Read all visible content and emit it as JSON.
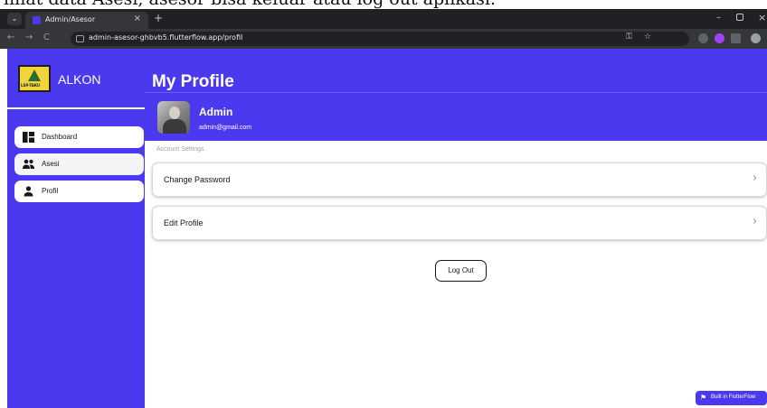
{
  "document_caption": "lihat data Asesi, asesor bisa keluar atau log out aplikasi.",
  "browser": {
    "tab_title": "Admin/Asesor",
    "tab_close": "×",
    "new_tab": "+",
    "url": "admin-asesor-ghbvb5.flutterflow.app/profil",
    "window_min": "–",
    "window_close": "×",
    "nav_back": "←",
    "nav_forward": "→",
    "nav_reload": "C",
    "url_key_icon": "⚿",
    "url_star_icon": "☆"
  },
  "sidebar": {
    "logo_text": "LSP-TAKU",
    "app_name": "ALKON",
    "items": [
      {
        "label": "Dashboard",
        "icon": "dashboard-icon"
      },
      {
        "label": "Asesi",
        "icon": "people-icon"
      },
      {
        "label": "Profil",
        "icon": "person-icon"
      }
    ]
  },
  "main": {
    "page_title": "My Profile",
    "profile": {
      "name": "Admin",
      "email": "admin@gmail.com"
    },
    "section_label": "Account Settings",
    "settings": [
      {
        "label": "Change Password",
        "chevron": "›"
      },
      {
        "label": "Edit Profile",
        "chevron": "›"
      }
    ],
    "logout_label": "Log Out"
  },
  "badge": {
    "label": "Built in FlutterFlow",
    "icon": "flutterflow-icon"
  },
  "colors": {
    "primary": "#4b39ef",
    "browser_dark": "#202124",
    "browser_bar": "#35363a",
    "text": "#14181b"
  }
}
